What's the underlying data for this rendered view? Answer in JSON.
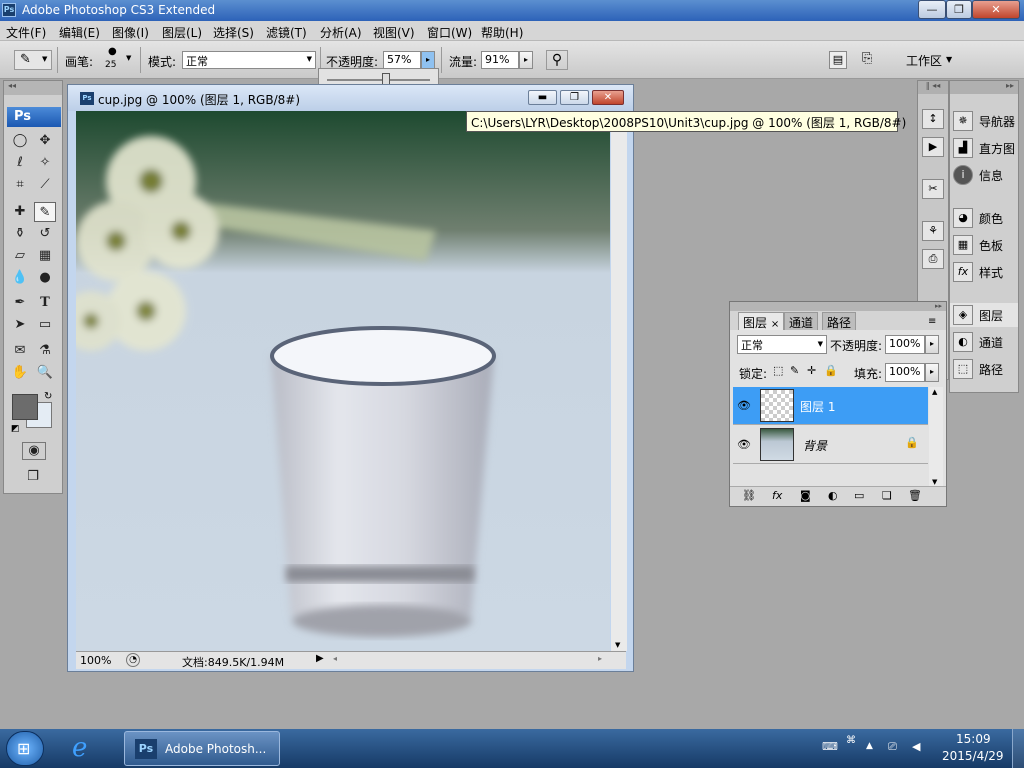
{
  "window": {
    "title": "Adobe Photoshop CS3 Extended",
    "ps_icon": "Ps"
  },
  "menu": [
    "文件(F)",
    "编辑(E)",
    "图像(I)",
    "图层(L)",
    "选择(S)",
    "滤镜(T)",
    "分析(A)",
    "视图(V)",
    "窗口(W)",
    "帮助(H)"
  ],
  "options": {
    "brush_label": "画笔:",
    "brush_size": "25",
    "mode_label": "模式:",
    "mode_value": "正常",
    "opacity_label": "不透明度:",
    "opacity_value": "57%",
    "flow_label": "流量:",
    "flow_value": "91%",
    "workspace_label": "工作区",
    "opacity_slider_fraction": 0.57
  },
  "tools": {
    "logo": "Ps"
  },
  "document": {
    "title": "cup.jpg @ 100% (图层 1, RGB/8#)",
    "zoom": "100%",
    "doc_info": "文档:849.5K/1.94M"
  },
  "tooltip": "C:\\Users\\LYR\\Desktop\\2008PS10\\Unit3\\cup.jpg @ 100% (图层 1, RGB/8#)",
  "dock": {
    "groups": [
      [
        "导航器",
        "直方图",
        "信息"
      ],
      [
        "颜色",
        "色板",
        "样式"
      ],
      [
        "图层",
        "通道",
        "路径"
      ]
    ]
  },
  "layers_panel": {
    "tabs": [
      "图层",
      "通道",
      "路径"
    ],
    "blend_mode": "正常",
    "opacity_label": "不透明度:",
    "opacity_value": "100%",
    "lock_label": "锁定:",
    "fill_label": "填充:",
    "fill_value": "100%",
    "layers": [
      {
        "name": "图层 1",
        "selected": true
      },
      {
        "name": "背景",
        "selected": false
      }
    ]
  },
  "taskbar": {
    "app_label": "Adobe Photosh...",
    "time": "15:09",
    "date": "2015/4/29"
  },
  "colors": {
    "accent": "#3d9df5",
    "title_bar": "#2d62b8",
    "selected_layer": "#3d9df5"
  }
}
